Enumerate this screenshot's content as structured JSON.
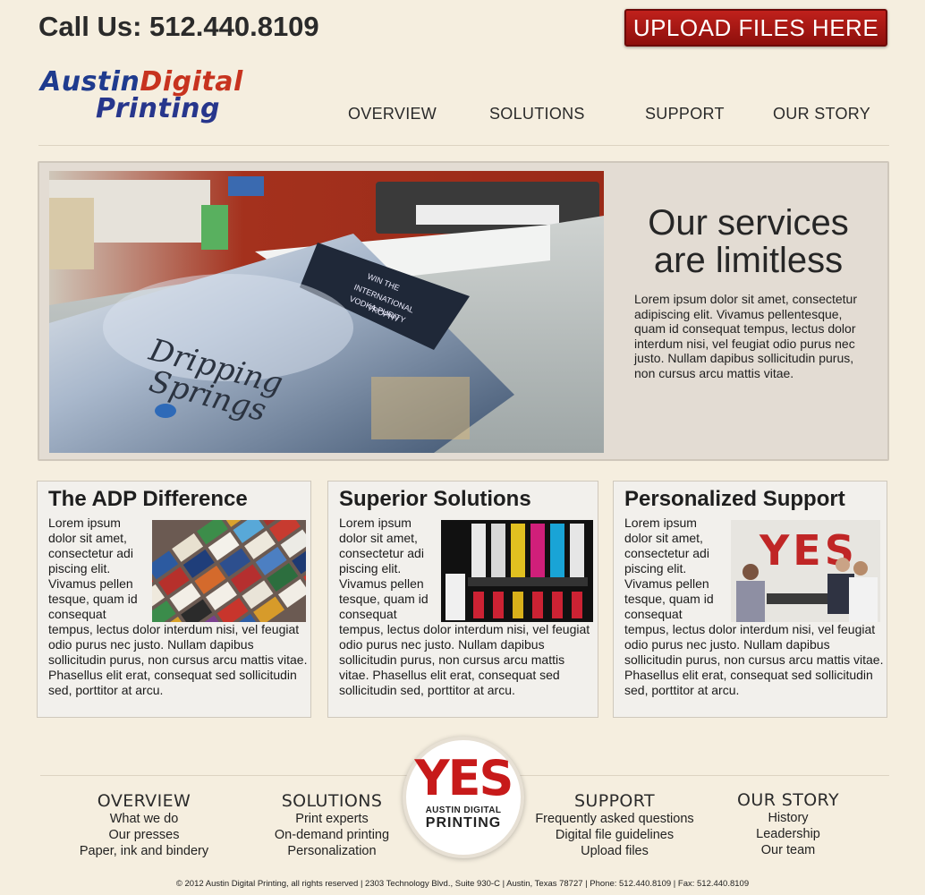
{
  "header": {
    "phone": "Call Us: 512.440.8109",
    "upload_button": "UPLOAD FILES HERE",
    "logo": {
      "line1_a": "Austin",
      "line1_b": "Digital",
      "line2": "Printing"
    }
  },
  "nav": [
    "OVERVIEW",
    "SOLUTIONS",
    "SUPPORT",
    "OUR STORY"
  ],
  "hero": {
    "title_line1": "Our services",
    "title_line2": "are limitless",
    "text": "Lorem ipsum dolor sit amet, consectetur adipiscing elit. Vivamus pellentesque, quam id consequat tempus, lectus dolor interdum nisi, vel feugiat odio purus nec justo. Nullam dapibus sollicitudin purus, non cursus arcu mattis vitae.",
    "image_text": [
      "WIN THE",
      "INTERNATIONAL",
      "VODKA PURITY",
      "TROPHY",
      "Dripping",
      "Springs"
    ]
  },
  "features": [
    {
      "title": "The ADP Difference",
      "text": "Lorem ipsum dolor sit amet, consectetur adi piscing elit. Vivamus pellen tesque, quam id consequat tempus, lectus dolor interdum nisi, vel feugiat odio purus nec justo. Nullam dapibus sollicitudin purus, non cursus arcu mattis vitae. Phasellus elit erat, consequat sed sollicitudin sed, porttitor at arcu."
    },
    {
      "title": "Superior Solutions",
      "text": "Lorem ipsum dolor sit amet, consectetur adi piscing elit. Vivamus pellen tesque, quam id consequat tempus, lectus dolor interdum nisi, vel feugiat odio purus nec justo. Nullam dapibus sollicitudin purus, non cursus arcu mattis vitae. Phasellus elit erat, consequat sed sollicitudin sed, porttitor at arcu."
    },
    {
      "title": "Personalized Support",
      "text": "Lorem ipsum dolor sit amet, consectetur adi piscing elit. Vivamus pellen tesque, quam id consequat tempus, lectus dolor interdum nisi, vel feugiat odio purus nec justo. Nullam dapibus sollicitudin purus, non cursus arcu mattis vitae. Phasellus elit erat, consequat sed sollicitudin sed, porttitor at arcu.",
      "image_text": "YES"
    }
  ],
  "footer": {
    "seal": {
      "big": "YES",
      "line1": "AUSTIN DIGITAL",
      "line2": "PRINTING"
    },
    "columns": [
      {
        "title": "OVERVIEW",
        "links": [
          "What we do",
          "Our presses",
          "Paper, ink and bindery"
        ]
      },
      {
        "title": "SOLUTIONS",
        "links": [
          "Print experts",
          "On-demand printing",
          "Personalization"
        ]
      },
      {
        "title": "SUPPORT",
        "links": [
          "Frequently asked questions",
          "Digital file guidelines",
          "Upload files"
        ]
      },
      {
        "title": "OUR STORY",
        "links": [
          "History",
          "Leadership",
          "Our team"
        ]
      }
    ],
    "copyright": "© 2012 Austin Digital Printing, all rights reserved   |   2303 Technology Blvd., Suite 930-C   |   Austin, Texas 78727   |   Phone: 512.440.8109   |   Fax: 512.440.8109"
  },
  "colors": {
    "background": "#f5eedf",
    "accent": "#b3171a",
    "logo_blue": "#1f3b8e",
    "logo_red": "#c7331f"
  }
}
